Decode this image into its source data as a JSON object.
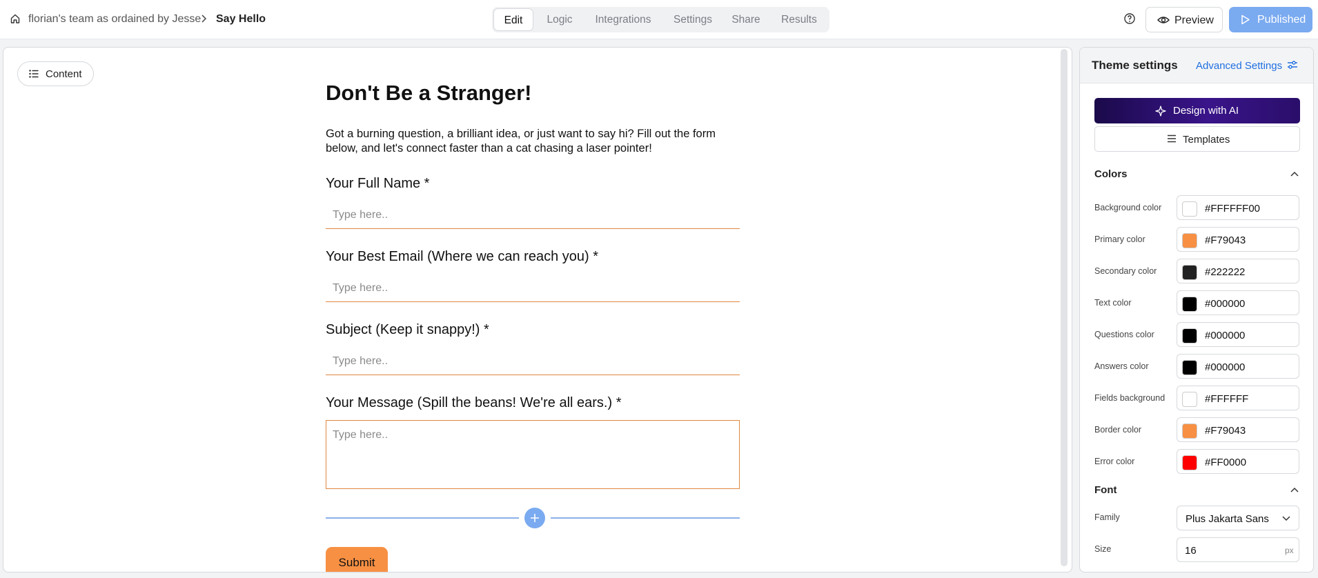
{
  "header": {
    "team": "florian's team as ordained by Jesse",
    "page": "Say Hello",
    "tabs": [
      "Edit",
      "Logic",
      "Integrations",
      "Settings",
      "Share",
      "Results"
    ],
    "active_tab": "Edit",
    "preview_label": "Preview",
    "published_label": "Published"
  },
  "canvas": {
    "content_button": "Content",
    "title": "Don't Be a Stranger!",
    "description": "Got a burning question, a brilliant idea, or just want to say hi? Fill out the form below, and let's connect faster than a cat chasing a laser pointer!",
    "questions": [
      {
        "label": "Your Full Name *",
        "placeholder": "Type here.."
      },
      {
        "label": "Your Best Email (Where we can reach you) *",
        "placeholder": "Type here.."
      },
      {
        "label": "Subject (Keep it snappy!) *",
        "placeholder": "Type here.."
      },
      {
        "label": "Your Message (Spill the beans! We're all ears.) *",
        "placeholder": "Type here.."
      }
    ],
    "submit_label": "Submit"
  },
  "theme": {
    "title": "Theme settings",
    "advanced_label": "Advanced Settings",
    "ai_label": "Design with AI",
    "templates_label": "Templates",
    "colors_title": "Colors",
    "colors": [
      {
        "label": "Background color",
        "value": "#FFFFFF00",
        "swatch": "#FFFFFF"
      },
      {
        "label": "Primary color",
        "value": "#F79043",
        "swatch": "#F79043"
      },
      {
        "label": "Secondary color",
        "value": "#222222",
        "swatch": "#222222"
      },
      {
        "label": "Text color",
        "value": "#000000",
        "swatch": "#000000"
      },
      {
        "label": "Questions color",
        "value": "#000000",
        "swatch": "#000000"
      },
      {
        "label": "Answers color",
        "value": "#000000",
        "swatch": "#000000"
      },
      {
        "label": "Fields background",
        "value": "#FFFFFF",
        "swatch": "#FFFFFF"
      },
      {
        "label": "Border color",
        "value": "#F79043",
        "swatch": "#F79043"
      },
      {
        "label": "Error color",
        "value": "#FF0000",
        "swatch": "#FF0000"
      }
    ],
    "font_title": "Font",
    "family_label": "Family",
    "family_value": "Plus Jakarta Sans",
    "size_label": "Size",
    "size_value": "16",
    "size_unit": "px"
  },
  "icons": [
    "home-icon",
    "chevron-right-icon",
    "help-icon",
    "eye-icon",
    "play-icon",
    "list-icon",
    "plus-icon",
    "sliders-icon",
    "sparkle-icon",
    "menu-icon",
    "chevron-up-icon",
    "chevron-down-icon"
  ]
}
